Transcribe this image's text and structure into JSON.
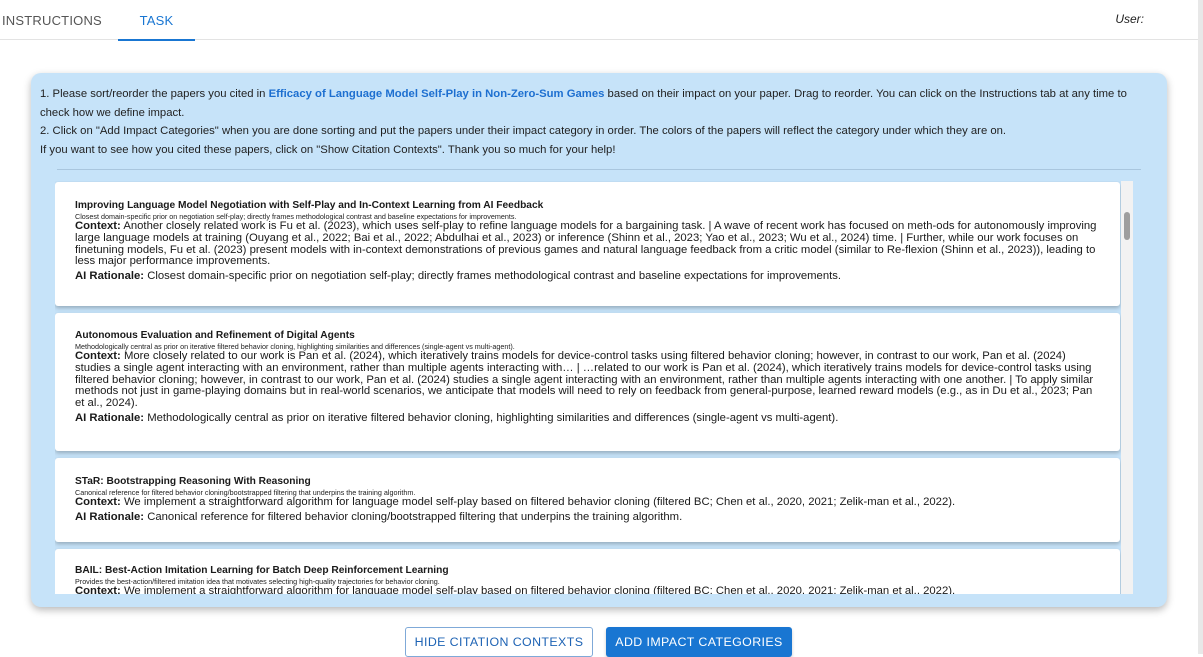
{
  "tabs": [
    {
      "label": "INSTRUCTIONS"
    },
    {
      "label": "TASK",
      "active": true
    }
  ],
  "user_label": "User:",
  "colors": {
    "accent": "#1976d2",
    "panel_bg": "#c6e3f9",
    "link": "#1d6fd0"
  },
  "intro": {
    "line1_prefix": "1. Please sort/reorder the papers you cited in ",
    "paper_title": "Efficacy of Language Model Self-Play in Non-Zero-Sum Games",
    "line1_suffix": " based on their impact on your paper. Drag to reorder. You can click on the Instructions tab at any time to check how we define impact.",
    "line2": "2. Click on \"Add Impact Categories\" when you are done sorting and put the papers under their impact category in order. The colors of the papers will reflect the category under which they are on.",
    "line3": "If you want to see how you cited these papers, click on \"Show Citation Contexts\". Thank you so much for your help!"
  },
  "labels": {
    "context": "Context:",
    "rationale": "AI Rationale:"
  },
  "papers": [
    {
      "title": "Improving Language Model Negotiation with Self-Play and In-Context Learning from AI Feedback",
      "subtitle": "Closest domain-specific prior on negotiation self-play; directly frames methodological contrast and baseline expectations for improvements.",
      "context": "Another closely related work is Fu et al. (2023), which uses self-play to refine language models for a bargaining task. | A wave of recent work has focused on meth-ods for autonomously improving large language models at training (Ouyang et al., 2022; Bai et al., 2022; Abdulhai et al., 2023) or inference (Shinn et al., 2023; Yao et al., 2023; Wu et al., 2024) time. | Further, while our work focuses on finetuning models, Fu et al. (2023) present models with in-context demonstrations of previous games and natural language feedback from a critic model (similar to Re-flexion (Shinn et al., 2023)), leading to less major performance improvements.",
      "rationale": "Closest domain-specific prior on negotiation self-play; directly frames methodological contrast and baseline expectations for improvements."
    },
    {
      "title": "Autonomous Evaluation and Refinement of Digital Agents",
      "subtitle": "Methodologically central as prior on iterative filtered behavior cloning, highlighting similarities and differences (single-agent vs multi-agent).",
      "context": "More closely related to our work is Pan et al. (2024), which iteratively trains models for device-control tasks using filtered behavior cloning; however, in contrast to our work, Pan et al. (2024) studies a single agent interacting with an environment, rather than multiple agents interacting with… | …related to our work is Pan et al. (2024), which iteratively trains models for device-control tasks using filtered behavior cloning; however, in contrast to our work, Pan et al. (2024) studies a single agent interacting with an environment, rather than multiple agents interacting with one another. | To apply similar methods not just in game-playing domains but in real-world scenarios, we anticipate that models will need to rely on feedback from general-purpose, learned reward models (e.g., as in Du et al., 2023; Pan et al., 2024).",
      "rationale": "Methodologically central as prior on iterative filtered behavior cloning, highlighting similarities and differences (single-agent vs multi-agent)."
    },
    {
      "title": "STaR: Bootstrapping Reasoning With Reasoning",
      "subtitle": "Canonical reference for filtered behavior cloning/bootstrapped filtering that underpins the training algorithm.",
      "context": "We implement a straightforward algorithm for language model self-play based on filtered behavior cloning (filtered BC; Chen et al., 2020, 2021; Zelik-man et al., 2022).",
      "rationale": "Canonical reference for filtered behavior cloning/bootstrapped filtering that underpins the training algorithm."
    },
    {
      "title": "BAIL: Best-Action Imitation Learning for Batch Deep Reinforcement Learning",
      "subtitle": "Provides the best-action/filtered imitation idea that motivates selecting high-quality trajectories for behavior cloning.",
      "context": "We implement a straightforward algorithm for language model self-play based on filtered behavior cloning (filtered BC; Chen et al., 2020, 2021; Zelik-man et al., 2022).",
      "rationale": ""
    }
  ],
  "buttons": {
    "hide_contexts": "HIDE CITATION CONTEXTS",
    "add_categories": "ADD IMPACT CATEGORIES"
  }
}
